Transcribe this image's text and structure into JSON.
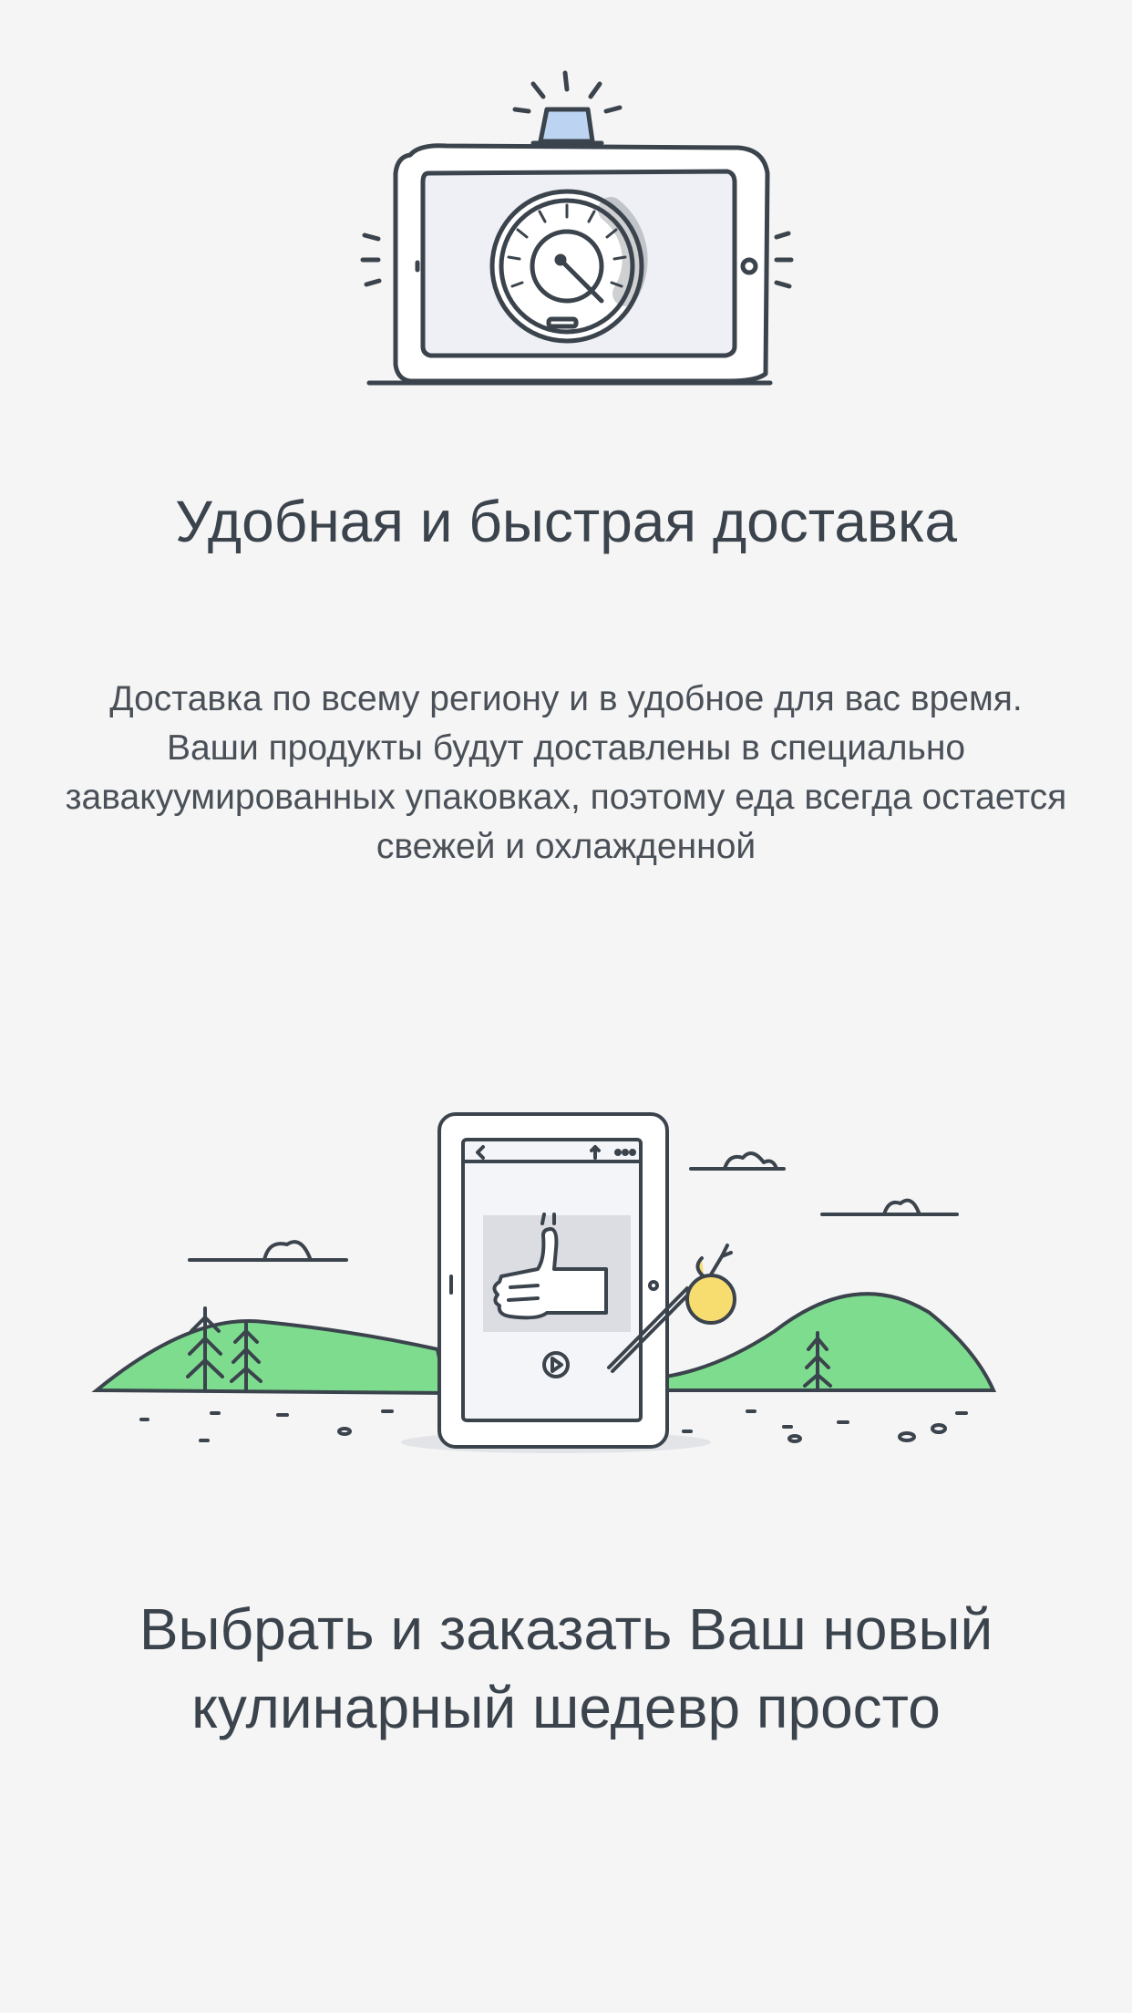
{
  "screen": {
    "background_color": "#f5f5f5",
    "text_color": "#3b434c",
    "accent_green": "#7edc8f",
    "accent_blue": "#bcd4f2",
    "accent_yellow": "#f7dc6f"
  },
  "section_delivery": {
    "illustration_icon": "speedometer-tablet-icon",
    "title": "Удобная и быстрая доставка",
    "description": "Доставка по всему региону и в удобное для вас время. Ваши продукты будут доставлены в специально завакуумированных упаковках, поэтому еда всегда остается свежей и охлажденной"
  },
  "section_order": {
    "illustration_icon": "tablet-landscape-thumbs-up-icon",
    "title": "Выбрать и заказать Ваш новый кулинарный шедевр просто"
  }
}
